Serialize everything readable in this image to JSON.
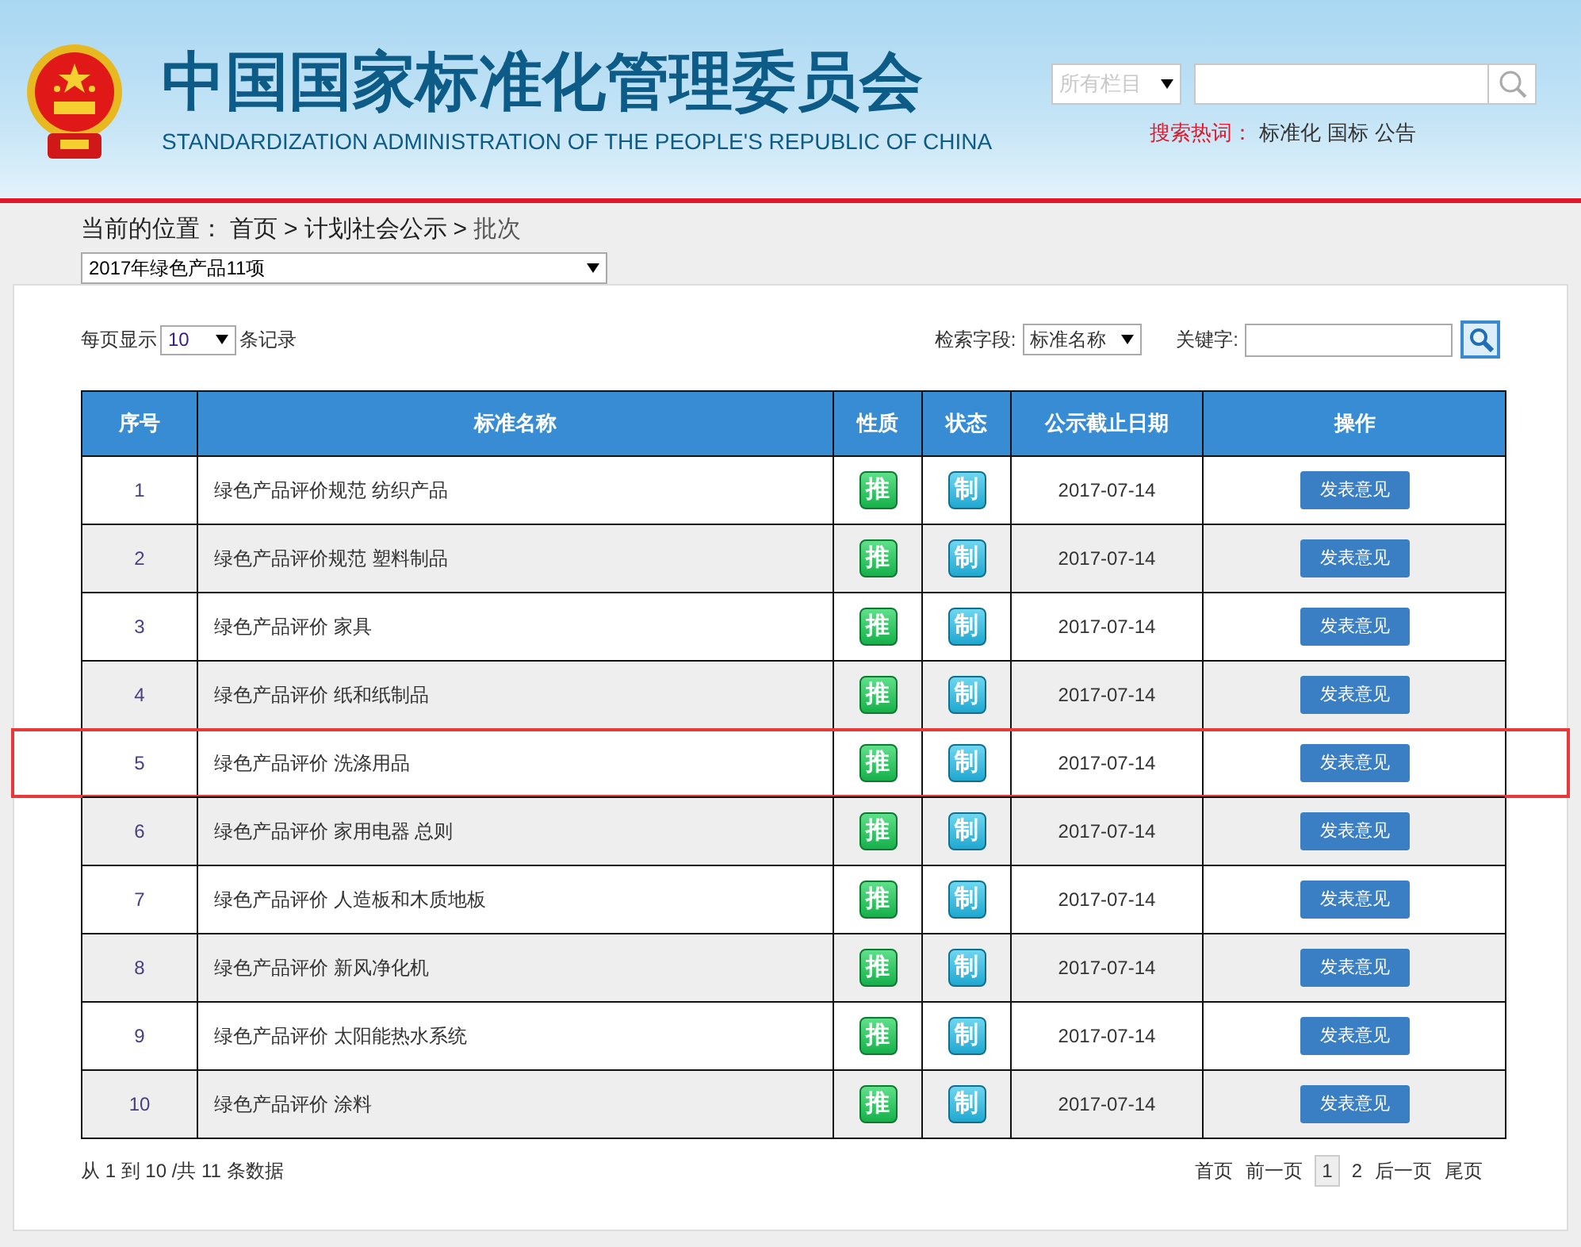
{
  "header": {
    "title": "中国国家标准化管理委员会",
    "subtitle": "STANDARDIZATION ADMINISTRATION OF THE PEOPLE'S REPUBLIC OF CHINA",
    "scope_select": "所有栏目",
    "hot_label": "搜索热词：",
    "hot_words": [
      "标准化",
      "国标",
      "公告"
    ]
  },
  "breadcrumb": {
    "label": "当前的位置：",
    "items": [
      "首页",
      ">",
      "计划社会公示",
      ">",
      "批次"
    ]
  },
  "batch_select": "2017年绿色产品11项",
  "page_size": {
    "before": "每页显示",
    "value": "10",
    "after": "条记录"
  },
  "search": {
    "field_label": "检索字段:",
    "field_value": "标准名称",
    "keyword_label": "关键字:"
  },
  "table": {
    "columns": [
      "序号",
      "标准名称",
      "性质",
      "状态",
      "公示截止日期",
      "操作"
    ],
    "rows": [
      {
        "no": "1",
        "name": "绿色产品评价规范 纺织产品",
        "nature": "推",
        "status": "制",
        "date": "2017-07-14",
        "action": "发表意见",
        "highlighted": false
      },
      {
        "no": "2",
        "name": "绿色产品评价规范 塑料制品",
        "nature": "推",
        "status": "制",
        "date": "2017-07-14",
        "action": "发表意见",
        "highlighted": false
      },
      {
        "no": "3",
        "name": "绿色产品评价 家具",
        "nature": "推",
        "status": "制",
        "date": "2017-07-14",
        "action": "发表意见",
        "highlighted": false
      },
      {
        "no": "4",
        "name": "绿色产品评价 纸和纸制品",
        "nature": "推",
        "status": "制",
        "date": "2017-07-14",
        "action": "发表意见",
        "highlighted": false
      },
      {
        "no": "5",
        "name": "绿色产品评价 洗涤用品",
        "nature": "推",
        "status": "制",
        "date": "2017-07-14",
        "action": "发表意见",
        "highlighted": true
      },
      {
        "no": "6",
        "name": "绿色产品评价 家用电器 总则",
        "nature": "推",
        "status": "制",
        "date": "2017-07-14",
        "action": "发表意见",
        "highlighted": false
      },
      {
        "no": "7",
        "name": "绿色产品评价 人造板和木质地板",
        "nature": "推",
        "status": "制",
        "date": "2017-07-14",
        "action": "发表意见",
        "highlighted": false
      },
      {
        "no": "8",
        "name": "绿色产品评价 新风净化机",
        "nature": "推",
        "status": "制",
        "date": "2017-07-14",
        "action": "发表意见",
        "highlighted": false
      },
      {
        "no": "9",
        "name": "绿色产品评价 太阳能热水系统",
        "nature": "推",
        "status": "制",
        "date": "2017-07-14",
        "action": "发表意见",
        "highlighted": false
      },
      {
        "no": "10",
        "name": "绿色产品评价 涂料",
        "nature": "推",
        "status": "制",
        "date": "2017-07-14",
        "action": "发表意见",
        "highlighted": false
      }
    ]
  },
  "summary": "从 1 到 10 /共 11 条数据",
  "pagination": [
    {
      "label": "首页",
      "selected": false
    },
    {
      "label": "前一页",
      "selected": false
    },
    {
      "label": "1",
      "selected": true
    },
    {
      "label": "2",
      "selected": false
    },
    {
      "label": "后一页",
      "selected": false
    },
    {
      "label": "尾页",
      "selected": false
    }
  ]
}
